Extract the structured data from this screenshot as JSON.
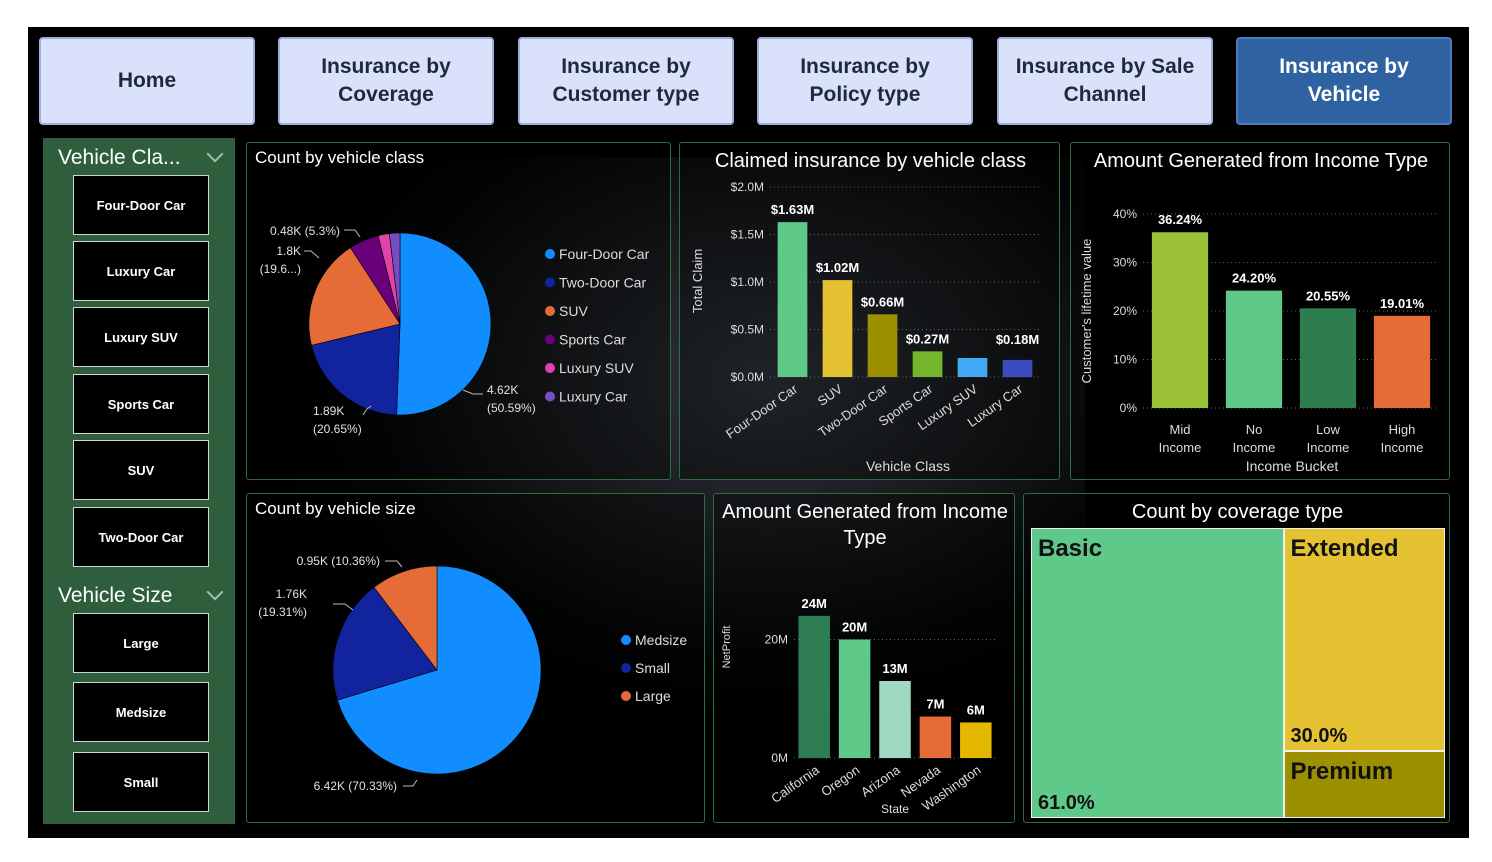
{
  "nav": [
    {
      "label": "Home",
      "active": false
    },
    {
      "label": "Insurance by Coverage",
      "active": false
    },
    {
      "label": "Insurance by Customer type",
      "active": false
    },
    {
      "label": "Insurance by Policy type",
      "active": false
    },
    {
      "label": "Insurance by Sale Channel",
      "active": false
    },
    {
      "label": "Insurance by Vehicle",
      "active": true
    }
  ],
  "slicers": {
    "vehicle_class": {
      "title": "Vehicle Cla...",
      "items": [
        "Four-Door Car",
        "Luxury Car",
        "Luxury SUV",
        "Sports Car",
        "SUV",
        "Two-Door Car"
      ]
    },
    "vehicle_size": {
      "title": "Vehicle Size",
      "items": [
        "Large",
        "Medsize",
        "Small"
      ]
    }
  },
  "titles": {
    "count_class": "Count by vehicle class",
    "claimed_class": "Claimed insurance by vehicle class",
    "income_type_top": "Amount Generated from Income Type",
    "count_size": "Count by vehicle size",
    "income_type_bottom": "Amount Generated from Income Type",
    "coverage": "Count by coverage type"
  },
  "chart_data": [
    {
      "id": "count_class",
      "type": "pie",
      "categories": [
        "Four-Door Car",
        "Two-Door Car",
        "SUV",
        "Sports Car",
        "Luxury SUV",
        "Luxury Car"
      ],
      "values": [
        50.59,
        20.65,
        19.6,
        5.3,
        2.0,
        1.86
      ],
      "colors": [
        "#118dff",
        "#12239e",
        "#e66c37",
        "#6b007b",
        "#e044a7",
        "#744ec2"
      ],
      "data_labels": [
        {
          "line1": "4.62K",
          "line2": "(50.59%)"
        },
        {
          "line1": "1.89K",
          "line2": "(20.65%)"
        },
        {
          "line1": "1.8K",
          "line2": "(19.6...)"
        },
        {
          "line1": "0.48K (5.3%)",
          "line2": ""
        }
      ],
      "legend": [
        "Four-Door Car",
        "Two-Door Car",
        "SUV",
        "Sports Car",
        "Luxury SUV",
        "Luxury Car"
      ]
    },
    {
      "id": "claimed_class",
      "type": "bar",
      "categories": [
        "Four-Door Car",
        "SUV",
        "Two-Door Car",
        "Sports Car",
        "Luxury SUV",
        "Luxury Car"
      ],
      "values": [
        1.63,
        1.02,
        0.66,
        0.27,
        0.2,
        0.18
      ],
      "value_labels": [
        "$1.63M",
        "$1.02M",
        "$0.66M",
        "$0.27M",
        "",
        "$0.18M"
      ],
      "colors": [
        "#5fc98a",
        "#e4c232",
        "#9c9000",
        "#74b52c",
        "#42a9f5",
        "#3b4bc0"
      ],
      "yticks": [
        "$0.0M",
        "$0.5M",
        "$1.0M",
        "$1.5M",
        "$2.0M"
      ],
      "ylim": [
        0,
        2
      ],
      "xlabel": "Vehicle Class",
      "ylabel": "Total Claim"
    },
    {
      "id": "income_type_top",
      "type": "bar",
      "categories": [
        "Mid Income",
        "No Income",
        "Low Income",
        "High Income"
      ],
      "values": [
        36.24,
        24.2,
        20.55,
        19.01
      ],
      "value_labels": [
        "36.24%",
        "24.20%",
        "20.55%",
        "19.01%"
      ],
      "colors": [
        "#9bc136",
        "#5fc98a",
        "#2e7d4f",
        "#e66c37"
      ],
      "yticks": [
        "0%",
        "10%",
        "20%",
        "30%",
        "40%"
      ],
      "ylim": [
        0,
        40
      ],
      "xlabel": "Income Bucket",
      "ylabel": "Customer's lifetime value"
    },
    {
      "id": "count_size",
      "type": "pie",
      "categories": [
        "Medsize",
        "Small",
        "Large"
      ],
      "values": [
        70.33,
        19.31,
        10.36
      ],
      "colors": [
        "#118dff",
        "#12239e",
        "#e66c37"
      ],
      "data_labels": [
        {
          "line1": "6.42K (70.33%)",
          "line2": ""
        },
        {
          "line1": "1.76K",
          "line2": "(19.31%)"
        },
        {
          "line1": "0.95K (10.36%)",
          "line2": ""
        }
      ],
      "legend": [
        "Medsize",
        "Small",
        "Large"
      ]
    },
    {
      "id": "income_type_bottom",
      "type": "bar",
      "categories": [
        "California",
        "Oregon",
        "Arizona",
        "Nevada",
        "Washington"
      ],
      "values": [
        24,
        20,
        13,
        7,
        6
      ],
      "value_labels": [
        "24M",
        "20M",
        "13M",
        "7M",
        "6M"
      ],
      "colors": [
        "#2f7d52",
        "#5fc98a",
        "#9fd9c2",
        "#e66c37",
        "#e4b800"
      ],
      "yticks": [
        "0M",
        "20M"
      ],
      "ylim": [
        0,
        26
      ],
      "xlabel": "State",
      "ylabel": "NetProfit"
    },
    {
      "id": "coverage",
      "type": "treemap",
      "categories": [
        "Basic",
        "Extended",
        "Premium"
      ],
      "values": [
        61.0,
        30.0,
        9.0
      ],
      "value_labels": [
        "61.0%",
        "30.0%",
        ""
      ],
      "colors": [
        "#5fc98a",
        "#e4c232",
        "#9c9000"
      ]
    }
  ]
}
